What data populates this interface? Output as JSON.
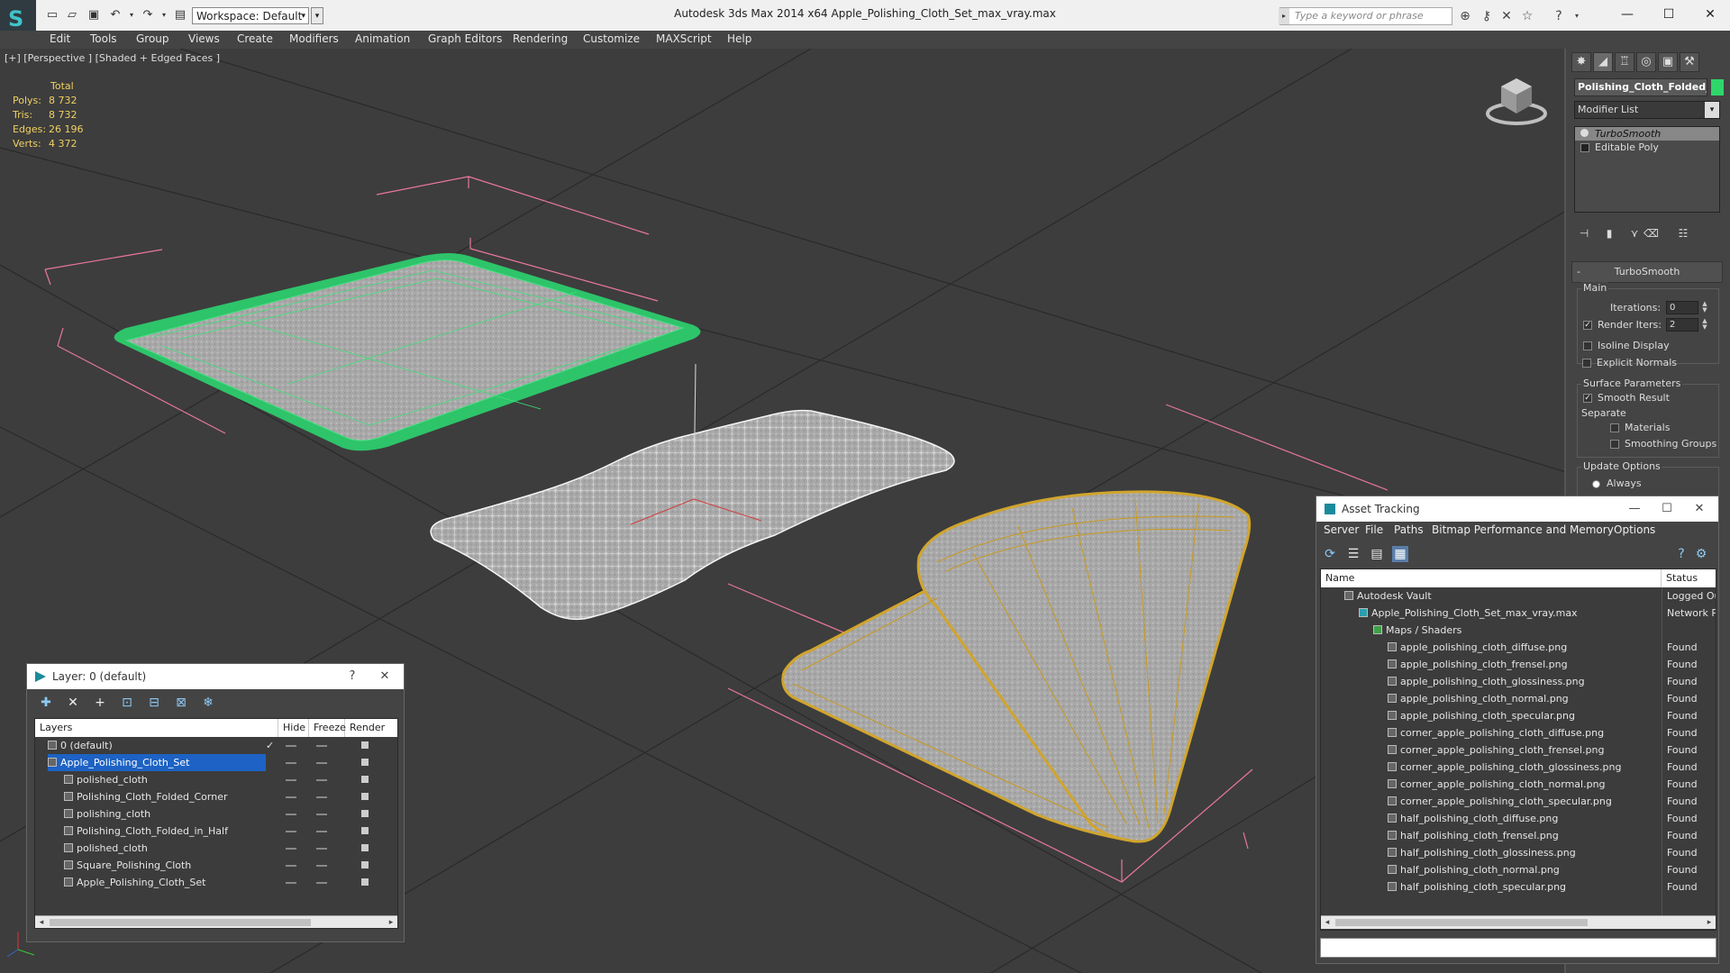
{
  "titlebar": {
    "title": "Autodesk 3ds Max  2014 x64     Apple_Polishing_Cloth_Set_max_vray.max",
    "workspace": "Workspace: Default",
    "search_placeholder": "Type a keyword or phrase"
  },
  "menu": [
    "Edit",
    "Tools",
    "Group",
    "Views",
    "Create",
    "Modifiers",
    "Animation",
    "Graph Editors",
    "Rendering",
    "Customize",
    "MAXScript",
    "Help"
  ],
  "viewport": {
    "label": "[+] [Perspective ] [Shaded + Edged Faces ]",
    "stats": {
      "header": "Total",
      "rows": [
        {
          "label": "Polys:",
          "value": "8 732"
        },
        {
          "label": "Tris:",
          "value": "8 732"
        },
        {
          "label": "Edges:",
          "value": "26 196"
        },
        {
          "label": "Verts:",
          "value": "4 372"
        }
      ]
    }
  },
  "command_panel": {
    "object_name": "Polishing_Cloth_Folded_i",
    "object_color": "#2fd76a",
    "modifier_list": "Modifier List",
    "stack": [
      "TurboSmooth",
      "Editable Poly"
    ],
    "rollout_title": "TurboSmooth",
    "main_group": "Main",
    "iterations_label": "Iterations:",
    "iterations_value": "0",
    "render_iters_label": "Render Iters:",
    "render_iters_value": "2",
    "isoline_label": "Isoline Display",
    "explicit_normals_label": "Explicit Normals",
    "surface_group": "Surface Parameters",
    "smooth_result_label": "Smooth Result",
    "separate_label": "Separate",
    "materials_label": "Materials",
    "smoothing_groups_label": "Smoothing Groups",
    "update_group": "Update Options",
    "always_label": "Always"
  },
  "layer_window": {
    "title": "Layer: 0 (default)",
    "help": "?",
    "columns": [
      "Layers",
      "Hide",
      "Freeze",
      "Render"
    ],
    "rows": [
      {
        "name": "0 (default)",
        "indent": 1,
        "selected": false
      },
      {
        "name": "Apple_Polishing_Cloth_Set",
        "indent": 1,
        "selected": true
      },
      {
        "name": "polished_cloth",
        "indent": 2,
        "selected": false
      },
      {
        "name": "Polishing_Cloth_Folded_Corner",
        "indent": 2,
        "selected": false
      },
      {
        "name": "polishing_cloth",
        "indent": 2,
        "selected": false
      },
      {
        "name": "Polishing_Cloth_Folded_in_Half",
        "indent": 2,
        "selected": false
      },
      {
        "name": "polished_cloth",
        "indent": 2,
        "selected": false
      },
      {
        "name": "Square_Polishing_Cloth",
        "indent": 2,
        "selected": false
      },
      {
        "name": "Apple_Polishing_Cloth_Set",
        "indent": 2,
        "selected": false
      }
    ]
  },
  "asset_window": {
    "title": "Asset Tracking",
    "menu": [
      "Server",
      "File",
      "Paths",
      "Bitmap Performance and Memory",
      "Options"
    ],
    "columns": [
      "Name",
      "Status"
    ],
    "rows": [
      {
        "name": "Autodesk Vault",
        "indent": 1,
        "status": "Logged Ou"
      },
      {
        "name": "Apple_Polishing_Cloth_Set_max_vray.max",
        "indent": 2,
        "status": "Network P"
      },
      {
        "name": "Maps / Shaders",
        "indent": 3,
        "status": ""
      },
      {
        "name": "apple_polishing_cloth_diffuse.png",
        "indent": 4,
        "status": "Found"
      },
      {
        "name": "apple_polishing_cloth_frensel.png",
        "indent": 4,
        "status": "Found"
      },
      {
        "name": "apple_polishing_cloth_glossiness.png",
        "indent": 4,
        "status": "Found"
      },
      {
        "name": "apple_polishing_cloth_normal.png",
        "indent": 4,
        "status": "Found"
      },
      {
        "name": "apple_polishing_cloth_specular.png",
        "indent": 4,
        "status": "Found"
      },
      {
        "name": "corner_apple_polishing_cloth_diffuse.png",
        "indent": 4,
        "status": "Found"
      },
      {
        "name": "corner_apple_polishing_cloth_frensel.png",
        "indent": 4,
        "status": "Found"
      },
      {
        "name": "corner_apple_polishing_cloth_glossiness.png",
        "indent": 4,
        "status": "Found"
      },
      {
        "name": "corner_apple_polishing_cloth_normal.png",
        "indent": 4,
        "status": "Found"
      },
      {
        "name": "corner_apple_polishing_cloth_specular.png",
        "indent": 4,
        "status": "Found"
      },
      {
        "name": "half_polishing_cloth_diffuse.png",
        "indent": 4,
        "status": "Found"
      },
      {
        "name": "half_polishing_cloth_frensel.png",
        "indent": 4,
        "status": "Found"
      },
      {
        "name": "half_polishing_cloth_glossiness.png",
        "indent": 4,
        "status": "Found"
      },
      {
        "name": "half_polishing_cloth_normal.png",
        "indent": 4,
        "status": "Found"
      },
      {
        "name": "half_polishing_cloth_specular.png",
        "indent": 4,
        "status": "Found"
      }
    ]
  }
}
